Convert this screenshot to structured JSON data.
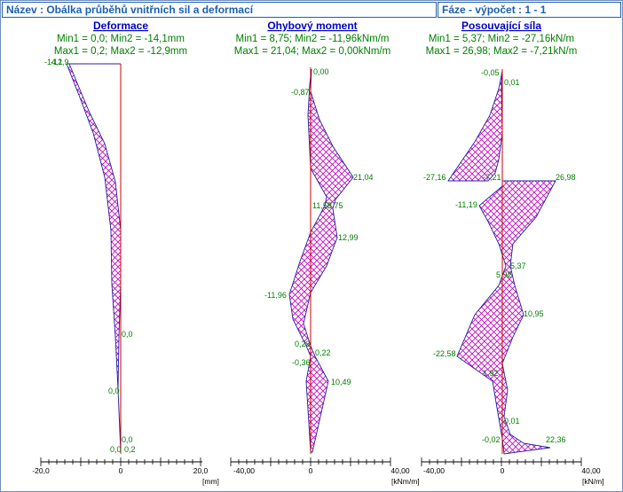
{
  "header": {
    "name_label": "Název : Obálka průběhů vnitřních sil a deformací",
    "phase_label": "Fáze - výpočet : 1 - 1"
  },
  "colors": {
    "title_blue": "#1a5fb4",
    "panel_title": "#0000c8",
    "stats_green": "#008000",
    "envelope": "#c000c0",
    "axis_red": "#d00000",
    "outline_blue": "#2020a0"
  },
  "panels": [
    {
      "title": "Deformace",
      "stats_line1": "Min1 = 0,0; Min2 = -14,1mm",
      "stats_line2": "Max1 = 0,2; Max2 = -12,9mm",
      "axis": {
        "min": "-20,0",
        "max": "20,0",
        "zero": "0",
        "unit": "[mm]"
      },
      "labels": [
        "-14,1",
        "-12,9",
        "0,0",
        "0,0",
        "0,0",
        "0,0",
        "0,2"
      ]
    },
    {
      "title": "Ohybový moment",
      "stats_line1": "Min1 = 8,75; Min2 = -11,96kNm/m",
      "stats_line2": "Max1 = 21,04; Max2 = 0,00kNm/m",
      "axis": {
        "min": "-40,00",
        "max": "40,00",
        "zero": "0",
        "unit": "[kNm/m]"
      },
      "labels": [
        "0,00",
        "-0,87",
        "21,04",
        "11,55",
        "8,75",
        "12,99",
        "-11,96",
        "0,23",
        "0,22",
        "-0,36",
        "10,49"
      ]
    },
    {
      "title": "Posouvající síla",
      "stats_line1": "Min1 = 5,37; Min2 = -27,16kN/m",
      "stats_line2": "Max1 = 26,98; Max2 = -7,21kN/m",
      "axis": {
        "min": "-40,00",
        "max": "40,00",
        "zero": "0",
        "unit": "[kN/m]"
      },
      "labels": [
        "-0,05",
        "0,01",
        "-27,16",
        "-7,21",
        "26,98",
        "-11,19",
        "5,37",
        "5,92",
        "10,95",
        "-22,58",
        "1,92",
        "0,01",
        "-0,02",
        "22,36"
      ]
    }
  ]
}
